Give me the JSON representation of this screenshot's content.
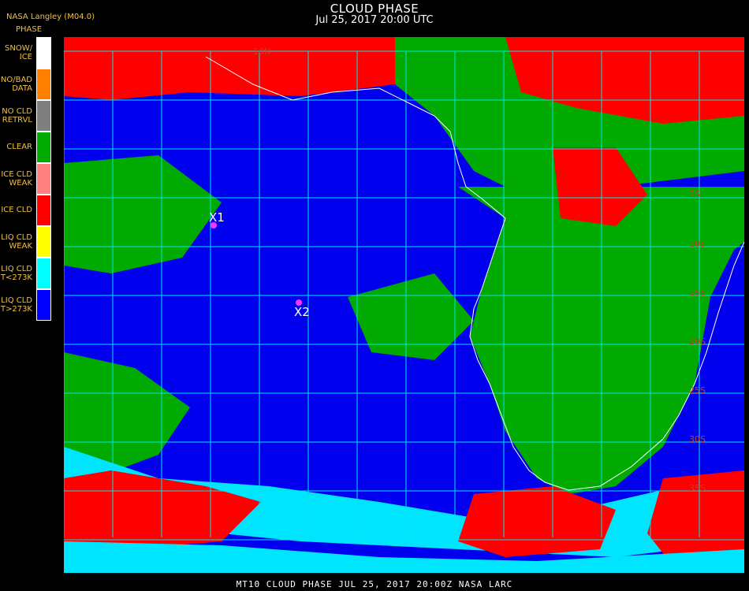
{
  "header": {
    "title": "CLOUD PHASE",
    "date": "Jul 25, 2017 20:00 UTC",
    "source": "NASA Langley (M04.0)"
  },
  "legend": {
    "title": "PHASE",
    "items": [
      {
        "label": "SNOW/\nICE",
        "color": "#ffffff"
      },
      {
        "label": "NO/BAD\nDATA",
        "color": "#ff7f00"
      },
      {
        "label": "NO CLD\nRETRVL",
        "color": "#7f7f7f"
      },
      {
        "label": "CLEAR",
        "color": "#00aa00"
      },
      {
        "label": "ICE CLD\nWEAK",
        "color": "#ff8080"
      },
      {
        "label": "ICE CLD",
        "color": "#ff0000"
      },
      {
        "label": "LIQ CLD\nWEAK",
        "color": "#ffff00"
      },
      {
        "label": "LIQ CLD\nT<273K",
        "color": "#00ffff"
      },
      {
        "label": "LIQ CLD\nT>273K",
        "color": "#0000ff"
      }
    ]
  },
  "map": {
    "markers": [
      {
        "label": "X1",
        "color": "#ff33ff"
      },
      {
        "label": "X2",
        "color": "#ff33ff"
      }
    ],
    "lat_labels": [
      "10N",
      "5S",
      "10S",
      "15S",
      "20S",
      "25S",
      "30S",
      "35S"
    ],
    "grid_color": "#00e5e5",
    "coast_color": "#ffffff",
    "lat_label_color": "#c04020"
  },
  "footer": {
    "text": "MT10  CLOUD PHASE   JUL 25, 2017 20:00Z   NASA LARC"
  }
}
